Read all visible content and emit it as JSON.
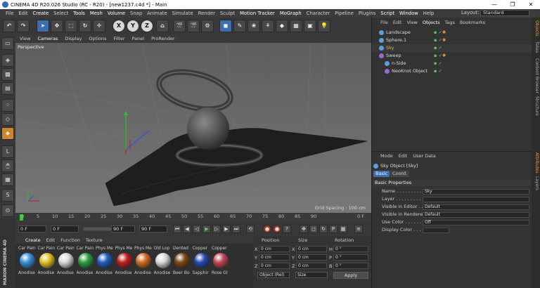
{
  "window": {
    "title": "CINEMA 4D R20.026 Studio (RC - R20) - [new1237.c4d *] - Main",
    "minimize": "—",
    "maximize": "❐",
    "close": "✕"
  },
  "menu": [
    "File",
    "Edit",
    "Create",
    "Select",
    "Tools",
    "Mesh",
    "Volume",
    "Snap",
    "Animate",
    "Simulate",
    "Render",
    "Sculpt",
    "Motion Tracker",
    "MoGraph",
    "Character",
    "Pipeline",
    "Plugins",
    "Script",
    "Window",
    "Help"
  ],
  "layout": {
    "label": "Layout:",
    "value": "Standard"
  },
  "toolbar": {
    "x_axis": "X",
    "y_axis": "Y",
    "z_axis": "Z"
  },
  "viewport": {
    "menu": [
      "View",
      "Cameras",
      "Display",
      "Options",
      "Filter",
      "Panel",
      "ProRender"
    ],
    "camera_label": "Perspective",
    "grid_spacing": "Grid Spacing : 100 cm"
  },
  "timeline": {
    "ticks": [
      "0",
      "5",
      "10",
      "15",
      "20",
      "25",
      "30",
      "35",
      "40",
      "45",
      "50",
      "55",
      "60",
      "65",
      "70",
      "75",
      "80",
      "85",
      "90"
    ],
    "end_label": "0 F"
  },
  "transport": {
    "start_frame": "0 F",
    "current_frame": "0 F",
    "end_frame": "90 F",
    "max_frame": "90 F"
  },
  "materials": {
    "menu": [
      "Create",
      "Edit",
      "Function",
      "Texture"
    ],
    "items": [
      {
        "name": "Car Pain",
        "label": "Anodise",
        "color": "#3a8fd8"
      },
      {
        "name": "Car Pain",
        "label": "Anodise",
        "color": "#e0c020"
      },
      {
        "name": "Car Pain",
        "label": "Anodise",
        "color": "#d8d8d8"
      },
      {
        "name": "Car Pain",
        "label": "Anodise",
        "color": "#2aa040"
      },
      {
        "name": "Phys Me",
        "label": "Anodise",
        "color": "#2060c0"
      },
      {
        "name": "Phys Me",
        "label": "Anodise",
        "color": "#c02020"
      },
      {
        "name": "Phys Me",
        "label": "Anodise",
        "color": "#d06a20"
      },
      {
        "name": "Old Lop",
        "label": "Anodise",
        "color": "#d8d8d8"
      },
      {
        "name": "Dented",
        "label": "Beer Bo",
        "color": "#7a4a1a"
      },
      {
        "name": "Copper",
        "label": "Sapphir",
        "color": "#2a4ab0"
      },
      {
        "name": "Copper",
        "label": "Rose Gl",
        "color": "#c04858"
      }
    ]
  },
  "coords": {
    "headers": [
      "Position",
      "Size",
      "Rotation"
    ],
    "rows": [
      {
        "axis": "X",
        "pos": "0 cm",
        "size": "0 cm",
        "rot_label": "H",
        "rot": "0 °"
      },
      {
        "axis": "Y",
        "pos": "0 cm",
        "size": "0 cm",
        "rot_label": "P",
        "rot": "0 °"
      },
      {
        "axis": "Z",
        "pos": "0 cm",
        "size": "0 cm",
        "rot_label": "B",
        "rot": "0 °"
      }
    ],
    "mode": "Object (Rel)",
    "size_mode": "Size",
    "apply": "Apply"
  },
  "objects": {
    "tabs": [
      "File",
      "Edit",
      "View",
      "Objects",
      "Tags",
      "Bookmarks"
    ],
    "items": [
      {
        "label": "Landscape",
        "color": "#5aa0e0",
        "indent": 0,
        "tag": "✱"
      },
      {
        "label": "Sphere.1",
        "color": "#5aa0e0",
        "indent": 0,
        "tag": "✱"
      },
      {
        "label": "Sky",
        "color": "#5aa0e0",
        "indent": 0,
        "tag": "",
        "selected": true
      },
      {
        "label": "Sweep",
        "color": "#9a6ad0",
        "indent": 0,
        "tag": "✱"
      },
      {
        "label": "n-Side",
        "color": "#5aa0e0",
        "indent": 1,
        "tag": ""
      },
      {
        "label": "NeoKnot Object",
        "color": "#9a6ad0",
        "indent": 1,
        "tag": ""
      }
    ]
  },
  "attributes": {
    "tabs": [
      "Mode",
      "Edit",
      "User Data"
    ],
    "object_title": "Sky Object [Sky]",
    "subtabs": [
      "Basic",
      "Coord."
    ],
    "section": "Basic Properties",
    "props": [
      {
        "label": "Name . . . . . . . . . . . .",
        "value": "Sky"
      },
      {
        "label": "Layer . . . . . . . . . . . .",
        "value": ""
      },
      {
        "label": "Visible in Editor . . .",
        "value": "Default"
      },
      {
        "label": "Visible in Renderer",
        "value": "Default"
      },
      {
        "label": "Use Color . . . . . . . .",
        "value": "Off"
      },
      {
        "label": "Display Color . . . .",
        "value": ""
      }
    ]
  },
  "side_tabs": [
    "Objects",
    "Takes",
    "Content Browser",
    "Structure",
    "Attributes",
    "Layers"
  ]
}
